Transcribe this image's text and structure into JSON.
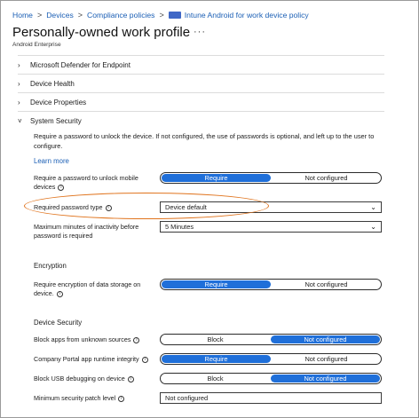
{
  "breadcrumb": {
    "items": [
      "Home",
      "Devices",
      "Compliance policies",
      "Intune Android for work device policy"
    ],
    "separator": ">"
  },
  "header": {
    "title": "Personally-owned work profile",
    "more": "···",
    "subtitle": "Android Enterprise"
  },
  "sections": [
    {
      "label": "Microsoft Defender for Endpoint",
      "chevron": "›"
    },
    {
      "label": "Device Health",
      "chevron": "›"
    },
    {
      "label": "Device Properties",
      "chevron": "›"
    },
    {
      "label": "System Security",
      "chevron": "˅"
    }
  ],
  "system_security": {
    "description": "Require a password to unlock the device. If not configured, the use of passwords is optional, and left up to the user to configure.",
    "learn_more": "Learn more",
    "require_password": {
      "label": "Require a password to unlock mobile devices",
      "options": [
        "Require",
        "Not configured"
      ],
      "selected": "Require"
    },
    "password_type": {
      "label": "Required password type",
      "value": "Device default"
    },
    "inactivity": {
      "label": "Maximum minutes of inactivity before password is required",
      "value": "5 Minutes"
    }
  },
  "encryption": {
    "heading": "Encryption",
    "require_encryption": {
      "label": "Require encryption of data storage on device.",
      "options": [
        "Require",
        "Not configured"
      ],
      "selected": "Require"
    }
  },
  "device_security": {
    "heading": "Device Security",
    "unknown_sources": {
      "label": "Block apps from unknown sources",
      "options": [
        "Block",
        "Not configured"
      ],
      "selected": "Not configured"
    },
    "portal_integrity": {
      "label": "Company Portal app runtime integrity",
      "options": [
        "Require",
        "Not configured"
      ],
      "selected": "Require"
    },
    "usb_debugging": {
      "label": "Block USB debugging on device",
      "options": [
        "Block",
        "Not configured"
      ],
      "selected": "Not configured"
    },
    "patch_level": {
      "label": "Minimum security patch level",
      "value": "Not configured"
    }
  },
  "icons": {
    "info": "i",
    "caret": "⌄"
  },
  "colors": {
    "accent": "#1f6fd9",
    "link": "#1b5fb5",
    "highlight": "#e0731c"
  }
}
